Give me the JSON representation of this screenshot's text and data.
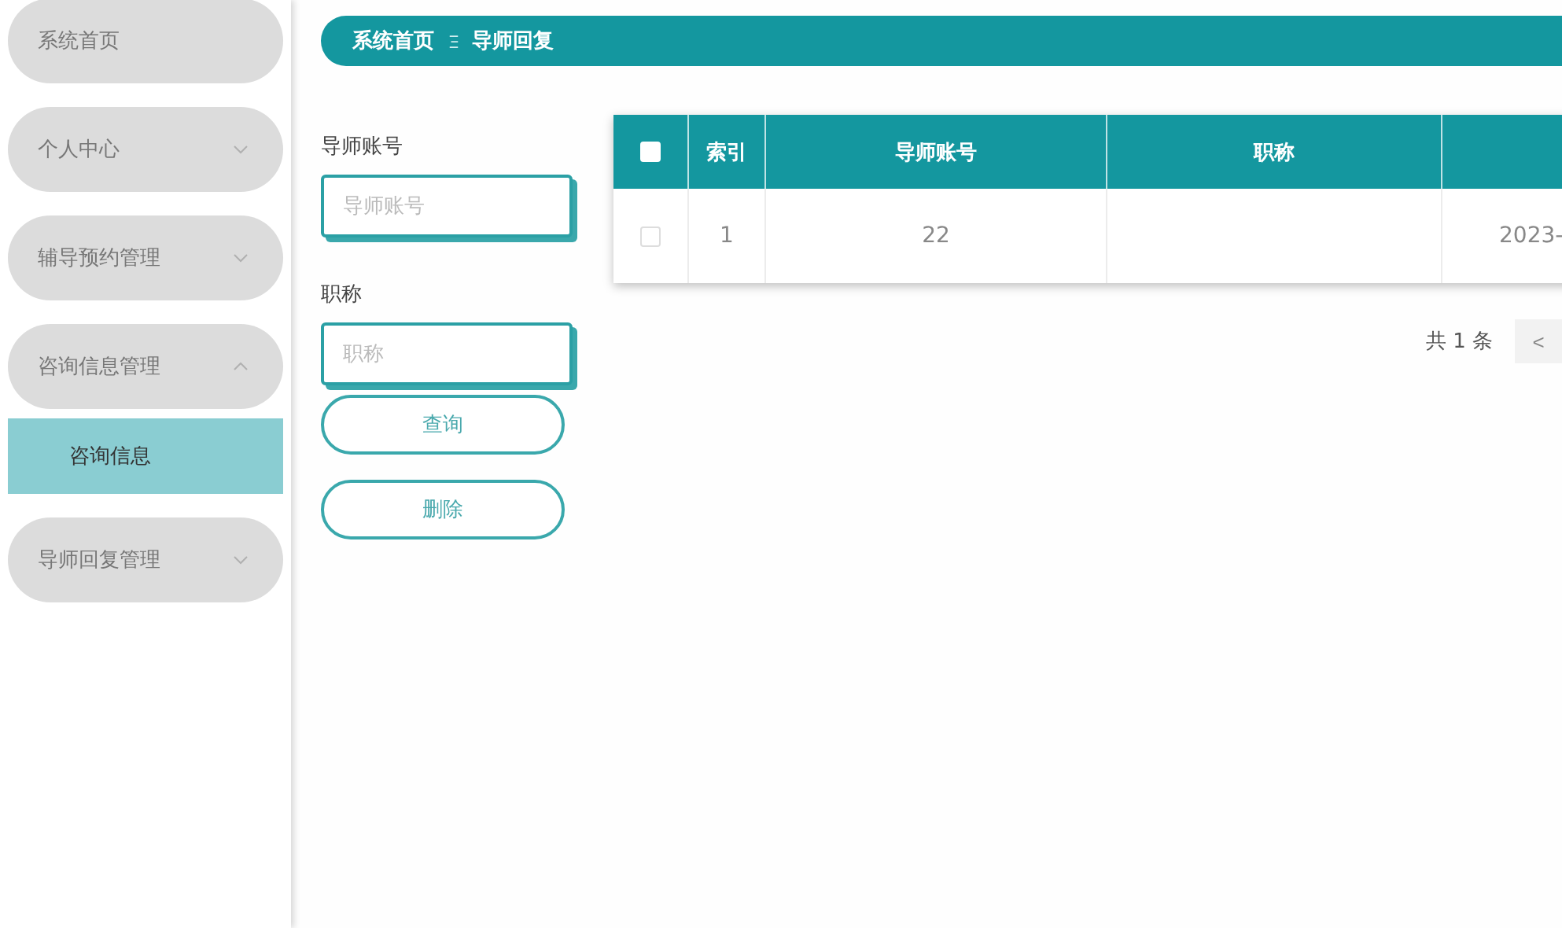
{
  "sidebar": {
    "items": [
      {
        "label": "系统首页",
        "kind": "link"
      },
      {
        "label": "个人中心",
        "kind": "menu",
        "expanded": false
      },
      {
        "label": "辅导预约管理",
        "kind": "menu",
        "expanded": false
      },
      {
        "label": "咨询信息管理",
        "kind": "menu",
        "expanded": true,
        "children": [
          {
            "label": "咨询信息",
            "selected": true
          }
        ]
      },
      {
        "label": "导师回复管理",
        "kind": "menu",
        "expanded": false
      }
    ]
  },
  "breadcrumb": [
    "系统首页",
    "导师回复"
  ],
  "filters": [
    {
      "label": "导师账号",
      "placeholder": "导师账号"
    },
    {
      "label": "职称",
      "placeholder": "职称"
    }
  ],
  "buttons": [
    "查询",
    "删除"
  ],
  "table": {
    "select_all": {
      "checked": false
    },
    "columns": [
      "索引",
      "导师账号",
      "职称"
    ],
    "rows": [
      {
        "checked": false,
        "index": "1",
        "account": "22",
        "column_5": "2023-"
      }
    ]
  },
  "pagination": {
    "total": "共 1 条",
    "prev": "<"
  }
}
